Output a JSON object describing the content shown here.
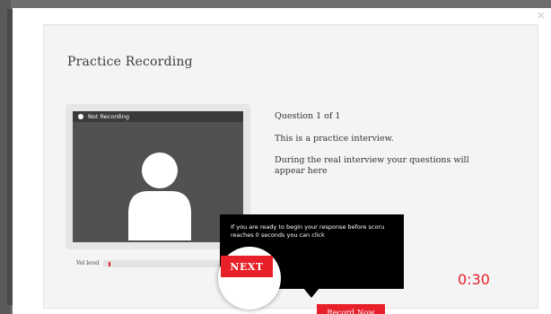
{
  "dialog": {
    "close_glyph": "×",
    "title": "Practice Recording"
  },
  "video": {
    "status": "Not Recording",
    "vol_label": "Vol level",
    "vol_level": 0.04
  },
  "question": {
    "count": "Question 1 of 1",
    "text": "This is a practice interview.",
    "note": "During the real interview your questions will appear here"
  },
  "tooltip": {
    "text": "If you are ready to begin your response before scoru reaches 0 seconds you can click",
    "next_label": "NEXT"
  },
  "timer": "0:30",
  "record_button": "Record Now",
  "colors": {
    "accent": "#e8202a",
    "video_bg": "#515151",
    "tooltip_bg": "#000000"
  },
  "icons": {
    "avatar": "user-silhouette-icon",
    "status_dot": "record-status-dot-icon"
  }
}
